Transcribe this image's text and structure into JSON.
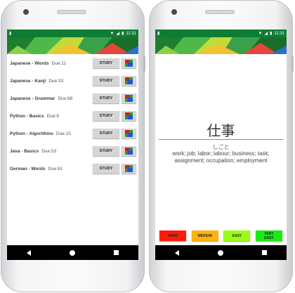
{
  "colors": {
    "statusbar": "#0e7d34",
    "hard": "#ff1a0a",
    "medium": "#ffb30a",
    "easy": "#9afc16",
    "very_easy": "#1aeb13"
  },
  "status": {
    "time": "11:31"
  },
  "decks": [
    {
      "name": "Japanese - Words",
      "due": "Due:11"
    },
    {
      "name": "Japanese - Kanji",
      "due": "Due:33"
    },
    {
      "name": "Japanese - Grammar",
      "due": "Due:88"
    },
    {
      "name": "Python - Basics",
      "due": "Due:6"
    },
    {
      "name": "Python - Algorithms",
      "due": "Due:15"
    },
    {
      "name": "Java - Basics",
      "due": "Due:53"
    },
    {
      "name": "German - Words",
      "due": "Due:61"
    }
  ],
  "study_label": "STUDY",
  "card": {
    "front": "仕事",
    "reading": "しごと",
    "meaning": "work; job; labor; labour; business; task; assignment; occupation; employment"
  },
  "grades": {
    "hard": "HARD",
    "medium": "MEDIUM",
    "easy": "EASY",
    "very_easy": "VERY EASY"
  }
}
